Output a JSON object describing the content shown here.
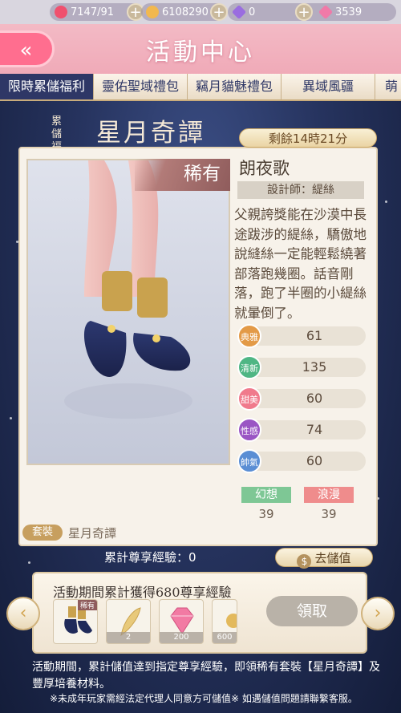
{
  "resources": [
    {
      "value": "7147/91",
      "icon": "heart-icon",
      "color": "#f0506e"
    },
    {
      "value": "6108290",
      "icon": "cat-coin-icon",
      "color": "#f2b84e"
    },
    {
      "value": "0",
      "icon": "purple-diamond-icon",
      "color": "#9a6de0"
    },
    {
      "value": "3539",
      "icon": "pink-diamond-icon",
      "color": "#f07aa8"
    }
  ],
  "header": {
    "back_label": "«",
    "title": "活動中心"
  },
  "tabs": [
    "限時累儲福利",
    "靈佑聖域禮包",
    "竊月貓魅禮包",
    "異域風疆",
    "萌"
  ],
  "banner": {
    "small_line1": "累儲",
    "small_line2": "福利",
    "big": "星月奇譚"
  },
  "timer": "剩餘14時21分",
  "item": {
    "rarity": "稀有",
    "name": "朗夜歌",
    "designer": "設計師：緹絲",
    "description": "父親誇獎能在沙漠中長途跋涉的緹絲，驕傲地說縫絲一定能輕鬆繞著部落跑幾圈。話音剛落，跑了半圈的小緹絲就暈倒了。",
    "stats": [
      {
        "label": "典雅",
        "value": "61",
        "color": "#e39a47"
      },
      {
        "label": "清新",
        "value": "135",
        "color": "#4fb684"
      },
      {
        "label": "甜美",
        "value": "60",
        "color": "#f07a8c"
      },
      {
        "label": "性感",
        "value": "74",
        "color": "#9a55c4"
      },
      {
        "label": "帥氣",
        "value": "60",
        "color": "#5a8ed4"
      }
    ],
    "tags": [
      {
        "label": "幻想",
        "value": "39",
        "color": "#7ec795"
      },
      {
        "label": "浪漫",
        "value": "39",
        "color": "#ef8c8c"
      }
    ],
    "suit_tag": "套裝",
    "suit_name": "星月奇譚"
  },
  "exp_text": "累計尊享經驗：0",
  "go_button": {
    "icon_char": "$",
    "label": "去儲值"
  },
  "reward": {
    "title": "活動期間累計獲得680尊享經驗",
    "items": [
      {
        "name": "shoes",
        "badge": "稀有",
        "count": ""
      },
      {
        "name": "feather",
        "count": "2"
      },
      {
        "name": "pink-diamond",
        "count": "200"
      },
      {
        "name": "gold-item",
        "count": "600"
      }
    ],
    "claim_label": "領取"
  },
  "arrows": {
    "left": "‹",
    "right": "›"
  },
  "notes": {
    "line1": "活動期間，累計儲值達到指定尊享經驗，即領稀有套裝【星月奇譚】及豐厚培養材料。",
    "line2": "※未成年玩家需經法定代理人同意方可儲值※ 如遇儲值問題請聯繫客服。"
  }
}
